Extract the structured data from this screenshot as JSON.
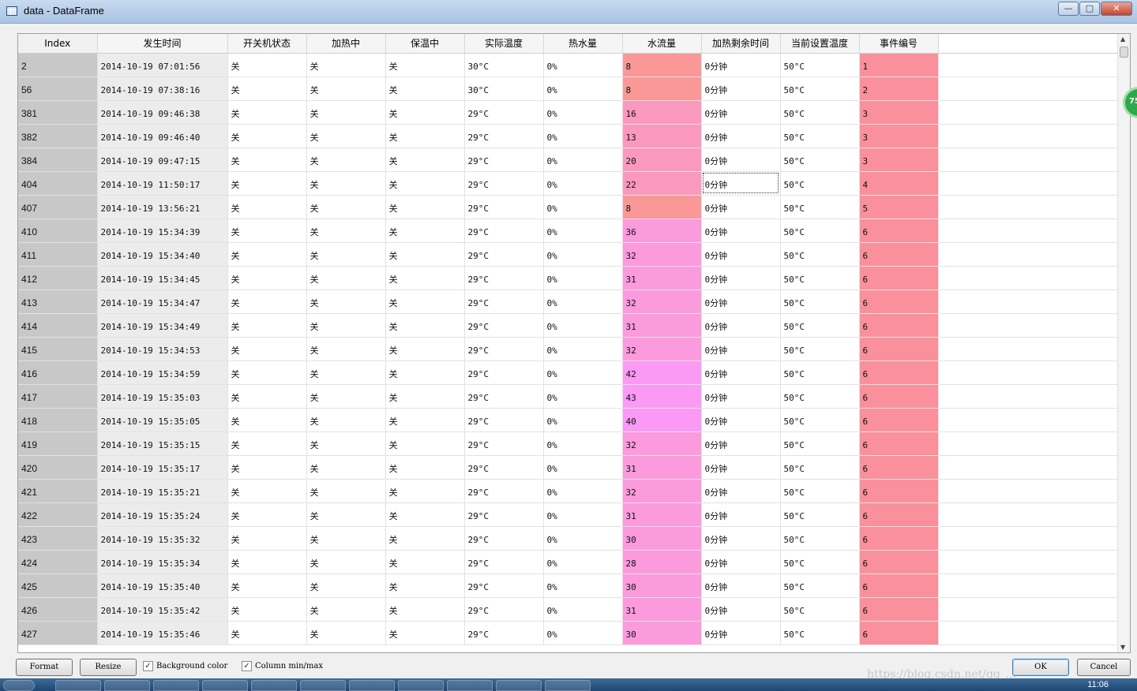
{
  "window": {
    "title": "data - DataFrame",
    "minimize": "—",
    "maximize": "□",
    "close": "✕"
  },
  "columns": [
    "Index",
    "发生时间",
    "开关机状态",
    "加热中",
    "保温中",
    "实际温度",
    "热水量",
    "水流量",
    "加热剩余时间",
    "当前设置温度",
    "事件编号"
  ],
  "colors": {
    "flow_low": "#fa9898",
    "flow_mid": "#fb99bd",
    "flow_high": "#fb9af5",
    "event": "#f9909c",
    "index_bg": "#c8c8c8"
  },
  "rows": [
    {
      "index": "2",
      "time": "2014-10-19 07:01:56",
      "power": "关",
      "heating": "关",
      "keepwarm": "关",
      "temp": "30°C",
      "hot": "0%",
      "flow": "8",
      "remain": "0分钟",
      "settemp": "50°C",
      "event": "1"
    },
    {
      "index": "56",
      "time": "2014-10-19 07:38:16",
      "power": "关",
      "heating": "关",
      "keepwarm": "关",
      "temp": "30°C",
      "hot": "0%",
      "flow": "8",
      "remain": "0分钟",
      "settemp": "50°C",
      "event": "2"
    },
    {
      "index": "381",
      "time": "2014-10-19 09:46:38",
      "power": "关",
      "heating": "关",
      "keepwarm": "关",
      "temp": "29°C",
      "hot": "0%",
      "flow": "16",
      "remain": "0分钟",
      "settemp": "50°C",
      "event": "3"
    },
    {
      "index": "382",
      "time": "2014-10-19 09:46:40",
      "power": "关",
      "heating": "关",
      "keepwarm": "关",
      "temp": "29°C",
      "hot": "0%",
      "flow": "13",
      "remain": "0分钟",
      "settemp": "50°C",
      "event": "3"
    },
    {
      "index": "384",
      "time": "2014-10-19 09:47:15",
      "power": "关",
      "heating": "关",
      "keepwarm": "关",
      "temp": "29°C",
      "hot": "0%",
      "flow": "20",
      "remain": "0分钟",
      "settemp": "50°C",
      "event": "3"
    },
    {
      "index": "404",
      "time": "2014-10-19 11:50:17",
      "power": "关",
      "heating": "关",
      "keepwarm": "关",
      "temp": "29°C",
      "hot": "0%",
      "flow": "22",
      "remain": "0分钟",
      "settemp": "50°C",
      "event": "4"
    },
    {
      "index": "407",
      "time": "2014-10-19 13:56:21",
      "power": "关",
      "heating": "关",
      "keepwarm": "关",
      "temp": "29°C",
      "hot": "0%",
      "flow": "8",
      "remain": "0分钟",
      "settemp": "50°C",
      "event": "5"
    },
    {
      "index": "410",
      "time": "2014-10-19 15:34:39",
      "power": "关",
      "heating": "关",
      "keepwarm": "关",
      "temp": "29°C",
      "hot": "0%",
      "flow": "36",
      "remain": "0分钟",
      "settemp": "50°C",
      "event": "6"
    },
    {
      "index": "411",
      "time": "2014-10-19 15:34:40",
      "power": "关",
      "heating": "关",
      "keepwarm": "关",
      "temp": "29°C",
      "hot": "0%",
      "flow": "32",
      "remain": "0分钟",
      "settemp": "50°C",
      "event": "6"
    },
    {
      "index": "412",
      "time": "2014-10-19 15:34:45",
      "power": "关",
      "heating": "关",
      "keepwarm": "关",
      "temp": "29°C",
      "hot": "0%",
      "flow": "31",
      "remain": "0分钟",
      "settemp": "50°C",
      "event": "6"
    },
    {
      "index": "413",
      "time": "2014-10-19 15:34:47",
      "power": "关",
      "heating": "关",
      "keepwarm": "关",
      "temp": "29°C",
      "hot": "0%",
      "flow": "32",
      "remain": "0分钟",
      "settemp": "50°C",
      "event": "6"
    },
    {
      "index": "414",
      "time": "2014-10-19 15:34:49",
      "power": "关",
      "heating": "关",
      "keepwarm": "关",
      "temp": "29°C",
      "hot": "0%",
      "flow": "31",
      "remain": "0分钟",
      "settemp": "50°C",
      "event": "6"
    },
    {
      "index": "415",
      "time": "2014-10-19 15:34:53",
      "power": "关",
      "heating": "关",
      "keepwarm": "关",
      "temp": "29°C",
      "hot": "0%",
      "flow": "32",
      "remain": "0分钟",
      "settemp": "50°C",
      "event": "6"
    },
    {
      "index": "416",
      "time": "2014-10-19 15:34:59",
      "power": "关",
      "heating": "关",
      "keepwarm": "关",
      "temp": "29°C",
      "hot": "0%",
      "flow": "42",
      "remain": "0分钟",
      "settemp": "50°C",
      "event": "6"
    },
    {
      "index": "417",
      "time": "2014-10-19 15:35:03",
      "power": "关",
      "heating": "关",
      "keepwarm": "关",
      "temp": "29°C",
      "hot": "0%",
      "flow": "43",
      "remain": "0分钟",
      "settemp": "50°C",
      "event": "6"
    },
    {
      "index": "418",
      "time": "2014-10-19 15:35:05",
      "power": "关",
      "heating": "关",
      "keepwarm": "关",
      "temp": "29°C",
      "hot": "0%",
      "flow": "40",
      "remain": "0分钟",
      "settemp": "50°C",
      "event": "6"
    },
    {
      "index": "419",
      "time": "2014-10-19 15:35:15",
      "power": "关",
      "heating": "关",
      "keepwarm": "关",
      "temp": "29°C",
      "hot": "0%",
      "flow": "32",
      "remain": "0分钟",
      "settemp": "50°C",
      "event": "6"
    },
    {
      "index": "420",
      "time": "2014-10-19 15:35:17",
      "power": "关",
      "heating": "关",
      "keepwarm": "关",
      "temp": "29°C",
      "hot": "0%",
      "flow": "31",
      "remain": "0分钟",
      "settemp": "50°C",
      "event": "6"
    },
    {
      "index": "421",
      "time": "2014-10-19 15:35:21",
      "power": "关",
      "heating": "关",
      "keepwarm": "关",
      "temp": "29°C",
      "hot": "0%",
      "flow": "32",
      "remain": "0分钟",
      "settemp": "50°C",
      "event": "6"
    },
    {
      "index": "422",
      "time": "2014-10-19 15:35:24",
      "power": "关",
      "heating": "关",
      "keepwarm": "关",
      "temp": "29°C",
      "hot": "0%",
      "flow": "31",
      "remain": "0分钟",
      "settemp": "50°C",
      "event": "6"
    },
    {
      "index": "423",
      "time": "2014-10-19 15:35:32",
      "power": "关",
      "heating": "关",
      "keepwarm": "关",
      "temp": "29°C",
      "hot": "0%",
      "flow": "30",
      "remain": "0分钟",
      "settemp": "50°C",
      "event": "6"
    },
    {
      "index": "424",
      "time": "2014-10-19 15:35:34",
      "power": "关",
      "heating": "关",
      "keepwarm": "关",
      "temp": "29°C",
      "hot": "0%",
      "flow": "28",
      "remain": "0分钟",
      "settemp": "50°C",
      "event": "6"
    },
    {
      "index": "425",
      "time": "2014-10-19 15:35:40",
      "power": "关",
      "heating": "关",
      "keepwarm": "关",
      "temp": "29°C",
      "hot": "0%",
      "flow": "30",
      "remain": "0分钟",
      "settemp": "50°C",
      "event": "6"
    },
    {
      "index": "426",
      "time": "2014-10-19 15:35:42",
      "power": "关",
      "heating": "关",
      "keepwarm": "关",
      "temp": "29°C",
      "hot": "0%",
      "flow": "31",
      "remain": "0分钟",
      "settemp": "50°C",
      "event": "6"
    },
    {
      "index": "427",
      "time": "2014-10-19 15:35:46",
      "power": "关",
      "heating": "关",
      "keepwarm": "关",
      "temp": "29°C",
      "hot": "0%",
      "flow": "30",
      "remain": "0分钟",
      "settemp": "50°C",
      "event": "6"
    }
  ],
  "selected_row_index": "404",
  "bottom": {
    "format_label": "Format",
    "resize_label": "Resize",
    "bg_color_label": "Background color",
    "bg_color_checked": true,
    "col_minmax_label": "Column min/max",
    "col_minmax_checked": true,
    "ok_label": "OK",
    "cancel_label": "Cancel"
  },
  "side_badge": "75",
  "taskbar": {
    "clock": "11:06"
  },
  "watermark": "https://blog.csdn.net/qq_..."
}
